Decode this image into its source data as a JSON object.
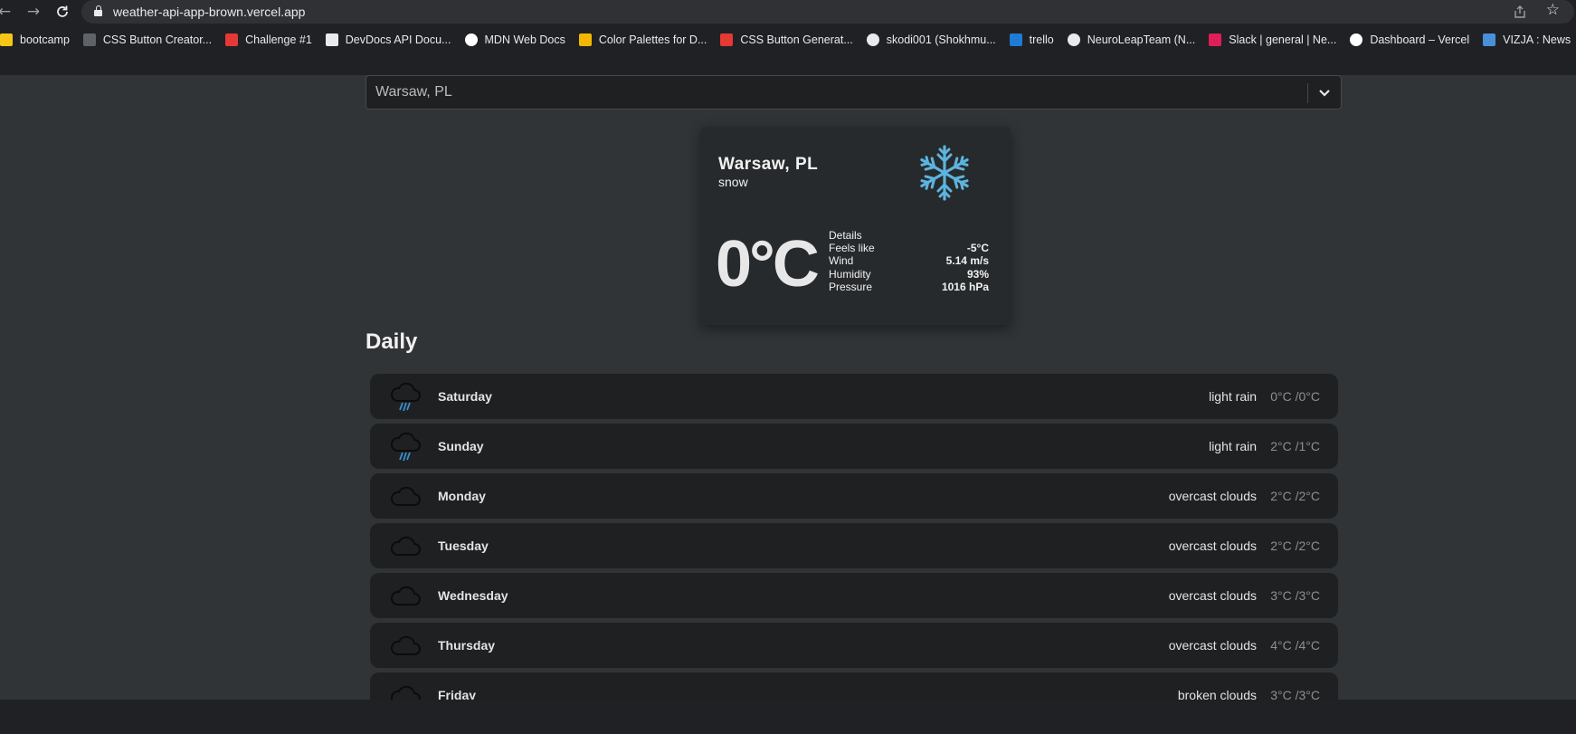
{
  "browser": {
    "url": "weather-api-app-brown.vercel.app",
    "bookmarks": [
      {
        "label": "bootcamp",
        "icon": "bootcamp-icon",
        "color": "#f5c518"
      },
      {
        "label": "CSS Button Creator...",
        "icon": "gear-icon",
        "color": "#5f6368"
      },
      {
        "label": "Challenge #1",
        "icon": "kp-icon",
        "color": "#e53935"
      },
      {
        "label": "DevDocs API Docu...",
        "icon": "devdocs-icon",
        "color": "#e8eaed"
      },
      {
        "label": "MDN Web Docs",
        "icon": "mdn-icon",
        "color": "#ffffff"
      },
      {
        "label": "Color Palettes for D...",
        "icon": "palette-icon",
        "color": "#f2b705"
      },
      {
        "label": "CSS Button Generat...",
        "icon": "star-burst-icon",
        "color": "#e53935"
      },
      {
        "label": "skodi001 (Shokhmu...",
        "icon": "github-icon",
        "color": "#e8eaed"
      },
      {
        "label": "trello",
        "icon": "trello-icon",
        "color": "#1f7bd6"
      },
      {
        "label": "NeuroLeapTeam (N...",
        "icon": "github-icon",
        "color": "#e8eaed"
      },
      {
        "label": "Slack | general | Ne...",
        "icon": "slack-icon",
        "color": "#e01e5a"
      },
      {
        "label": "Dashboard – Vercel",
        "icon": "vercel-icon",
        "color": "#ffffff"
      },
      {
        "label": "VIZJA : News",
        "icon": "vizja-icon",
        "color": "#4a90d9"
      }
    ]
  },
  "search": {
    "selected": "Warsaw, PL"
  },
  "current": {
    "city": "Warsaw, PL",
    "description": "snow",
    "icon": "snowflake-icon",
    "temperature": "0°C",
    "details_label": "Details",
    "details": [
      {
        "label": "Feels like",
        "value": "-5°C"
      },
      {
        "label": "Wind",
        "value": "5.14 m/s"
      },
      {
        "label": "Humidity",
        "value": "93%"
      },
      {
        "label": "Pressure",
        "value": "1016 hPa"
      }
    ]
  },
  "daily": {
    "title": "Daily",
    "days": [
      {
        "name": "Saturday",
        "description": "light rain",
        "temps": "0°C /0°C",
        "icon": "rain-cloud-icon"
      },
      {
        "name": "Sunday",
        "description": "light rain",
        "temps": "2°C /1°C",
        "icon": "rain-cloud-icon"
      },
      {
        "name": "Monday",
        "description": "overcast clouds",
        "temps": "2°C /2°C",
        "icon": "cloud-icon"
      },
      {
        "name": "Tuesday",
        "description": "overcast clouds",
        "temps": "2°C /2°C",
        "icon": "cloud-icon"
      },
      {
        "name": "Wednesday",
        "description": "overcast clouds",
        "temps": "3°C /3°C",
        "icon": "cloud-icon"
      },
      {
        "name": "Thursday",
        "description": "overcast clouds",
        "temps": "4°C /4°C",
        "icon": "cloud-icon"
      },
      {
        "name": "Friday",
        "description": "broken clouds",
        "temps": "3°C /3°C",
        "icon": "cloud-icon"
      }
    ]
  },
  "colors": {
    "snowflake": "#5db4de",
    "rain": "#3a8fd0"
  }
}
